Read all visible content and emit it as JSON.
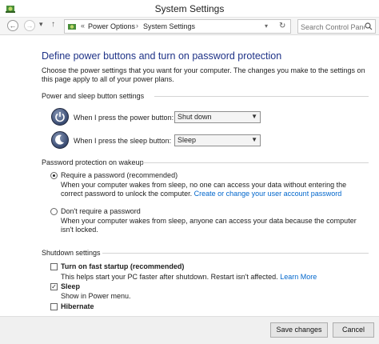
{
  "window": {
    "title": "System Settings"
  },
  "nav": {
    "back_icon": "back-arrow-icon",
    "forward_icon": "forward-arrow-icon",
    "up_icon": "up-arrow-icon",
    "address": {
      "overflow": "«",
      "crumbs": [
        "Power Options",
        "System Settings"
      ],
      "refresh_icon": "refresh-icon"
    },
    "search": {
      "placeholder": "Search Control Panel"
    }
  },
  "page": {
    "heading": "Define power buttons and turn on password protection",
    "intro": "Choose the power settings that you want for your computer. The changes you make to the settings on this page apply to all of your power plans."
  },
  "power_sleep": {
    "label": "Power and sleep button settings",
    "power_button": {
      "label": "When I press the power button:",
      "value": "Shut down"
    },
    "sleep_button": {
      "label": "When I press the sleep button:",
      "value": "Sleep"
    }
  },
  "wakeup": {
    "label": "Password protection on wakeup",
    "require": {
      "label": "Require a password (recommended)",
      "checked": true,
      "desc": "When your computer wakes from sleep, no one can access your data without entering the correct password to unlock the computer.",
      "link": "Create or change your user account password"
    },
    "dont_require": {
      "label": "Don't require a password",
      "checked": false,
      "desc": "When your computer wakes from sleep, anyone can access your data because the computer isn't locked."
    }
  },
  "shutdown": {
    "label": "Shutdown settings",
    "fast_startup": {
      "label": "Turn on fast startup (recommended)",
      "checked": false,
      "desc": "This helps start your PC faster after shutdown. Restart isn't affected.",
      "link": "Learn More"
    },
    "sleep": {
      "label": "Sleep",
      "checked": true,
      "desc": "Show in Power menu."
    },
    "hibernate": {
      "label": "Hibernate",
      "checked": false
    }
  },
  "footer": {
    "save": "Save changes",
    "cancel": "Cancel"
  },
  "colors": {
    "heading": "#1e3287",
    "link": "#0066cc",
    "footer_bg": "#f0f0f0"
  }
}
